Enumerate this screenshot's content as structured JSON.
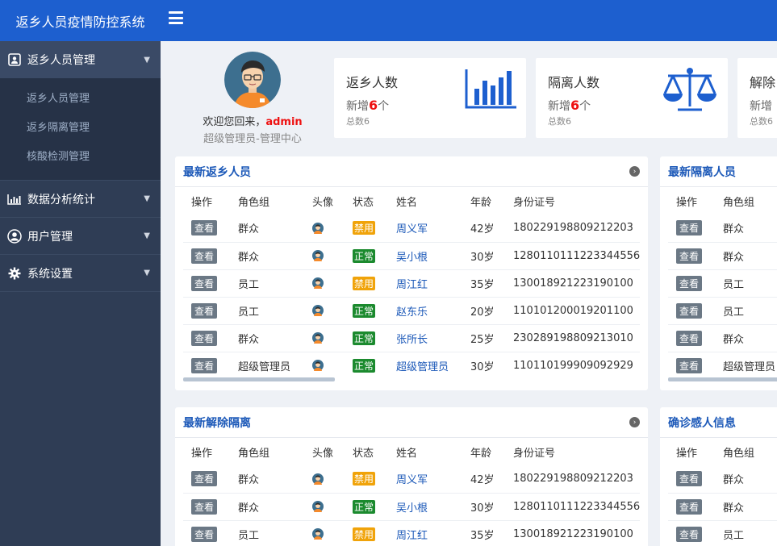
{
  "app": {
    "title": "返乡人员疫情防控系统"
  },
  "sidebar": {
    "groups": [
      {
        "label": "返乡人员管理",
        "icon": "contact-card-icon",
        "items": [
          {
            "label": "返乡人员管理"
          },
          {
            "label": "返乡隔离管理"
          },
          {
            "label": "核酸检测管理"
          }
        ]
      },
      {
        "label": "数据分析统计",
        "icon": "bar-chart-icon"
      },
      {
        "label": "用户管理",
        "icon": "user-icon"
      },
      {
        "label": "系统设置",
        "icon": "gear-icon"
      }
    ]
  },
  "welcome": {
    "greeting": "欢迎您回来，",
    "username": "admin",
    "role": "超级管理员-管理中心"
  },
  "stats": [
    {
      "title": "返乡人数",
      "new_prefix": "新增",
      "new_count": "6",
      "new_suffix": "个",
      "total": "总数6",
      "icon": "bar-chart-icon"
    },
    {
      "title": "隔离人数",
      "new_prefix": "新增",
      "new_count": "6",
      "new_suffix": "个",
      "total": "总数6",
      "icon": "scale-icon"
    },
    {
      "title": "解除",
      "new_prefix": "新增",
      "total": "总数6"
    }
  ],
  "columns": [
    "操作",
    "角色组",
    "头像",
    "状态",
    "姓名",
    "年龄",
    "身份证号"
  ],
  "view_label": "查看",
  "panels": {
    "returnees": {
      "title": "最新返乡人员",
      "rows": [
        {
          "role": "群众",
          "status": "禁用",
          "status_type": "off",
          "name": "周义军",
          "age": "42岁",
          "id": "180229198809212203"
        },
        {
          "role": "群众",
          "status": "正常",
          "status_type": "on",
          "name": "吴小根",
          "age": "30岁",
          "id": "1280110111223344556"
        },
        {
          "role": "员工",
          "status": "禁用",
          "status_type": "off",
          "name": "周江红",
          "age": "35岁",
          "id": "130018921223190100"
        },
        {
          "role": "员工",
          "status": "正常",
          "status_type": "on",
          "name": "赵东乐",
          "age": "20岁",
          "id": "110101200019201100"
        },
        {
          "role": "群众",
          "status": "正常",
          "status_type": "on",
          "name": "张所长",
          "age": "25岁",
          "id": "230289198809213010"
        },
        {
          "role": "超级管理员",
          "status": "正常",
          "status_type": "on",
          "name": "超级管理员",
          "age": "30岁",
          "id": "110110199909092929"
        }
      ]
    },
    "isolation": {
      "title": "最新隔离人员",
      "rows": [
        {
          "role": "群众"
        },
        {
          "role": "群众"
        },
        {
          "role": "员工"
        },
        {
          "role": "员工"
        },
        {
          "role": "群众"
        },
        {
          "role": "超级管理员"
        }
      ]
    },
    "released": {
      "title": "最新解除隔离",
      "rows": [
        {
          "role": "群众",
          "status": "禁用",
          "status_type": "off",
          "name": "周义军",
          "age": "42岁",
          "id": "180229198809212203"
        },
        {
          "role": "群众",
          "status": "正常",
          "status_type": "on",
          "name": "吴小根",
          "age": "30岁",
          "id": "1280110111223344556"
        },
        {
          "role": "员工",
          "status": "禁用",
          "status_type": "off",
          "name": "周江红",
          "age": "35岁",
          "id": "130018921223190100"
        }
      ]
    },
    "confirmed": {
      "title": "确诊感人信息",
      "rows": [
        {
          "role": "群众"
        },
        {
          "role": "群众"
        },
        {
          "role": "员工"
        }
      ]
    }
  },
  "colors": {
    "primary": "#1d5fcf",
    "sidebar": "#2f3d55",
    "disabled": "#f0a30a",
    "normal": "#1b8a2e",
    "link": "#1b58b8"
  }
}
